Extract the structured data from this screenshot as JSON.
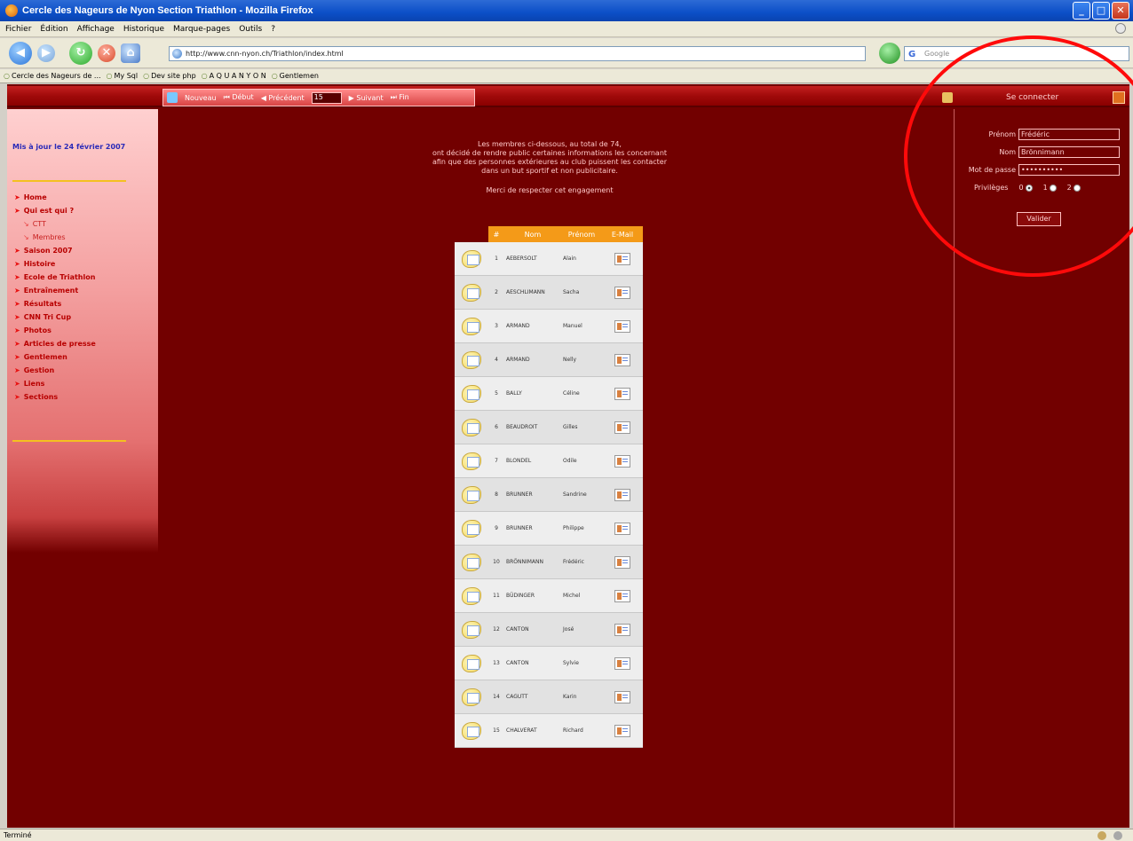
{
  "window": {
    "title": "Cercle des Nageurs de Nyon Section Triathlon - Mozilla Firefox"
  },
  "menu": [
    "Fichier",
    "Édition",
    "Affichage",
    "Historique",
    "Marque-pages",
    "Outils",
    "?"
  ],
  "address": {
    "url": "http://www.cnn-nyon.ch/Triathlon/index.html",
    "search_placeholder": "Google"
  },
  "bookmarks": [
    "Cercle des Nageurs de ...",
    "My Sql",
    "Dev site php",
    "A Q U A N Y O N",
    "Gentlemen"
  ],
  "pager": {
    "nouveau": "Nouveau",
    "debut": "Début",
    "precedent": "Précédent",
    "value": "15",
    "suivant": "Suivant",
    "fin": "Fin"
  },
  "connect": {
    "label": "Se connecter"
  },
  "sidebar": {
    "updated": "Mis à jour le 24 février 2007",
    "items": [
      {
        "label": "Home",
        "sub": false
      },
      {
        "label": "Qui est qui ?",
        "sub": false
      },
      {
        "label": "CTT",
        "sub": true
      },
      {
        "label": "Membres",
        "sub": true
      },
      {
        "label": "Saison 2007",
        "sub": false
      },
      {
        "label": "Histoire",
        "sub": false
      },
      {
        "label": "Ecole de Triathlon",
        "sub": false
      },
      {
        "label": "Entraînement",
        "sub": false
      },
      {
        "label": "Résultats",
        "sub": false
      },
      {
        "label": "CNN Tri Cup",
        "sub": false
      },
      {
        "label": "Photos",
        "sub": false
      },
      {
        "label": "Articles de presse",
        "sub": false
      },
      {
        "label": "Gentlemen",
        "sub": false
      },
      {
        "label": "Gestion",
        "sub": false
      },
      {
        "label": "Liens",
        "sub": false
      },
      {
        "label": "Sections",
        "sub": false
      }
    ]
  },
  "intro": {
    "lines": [
      "Les membres ci-dessous, au total de 74,",
      "ont décidé de rendre public certaines informations les concernant",
      "afin que des personnes extérieures au club puissent les contacter",
      "dans un but sportif et non publicitaire."
    ],
    "respect": "Merci de respecter cet engagement"
  },
  "members": {
    "headers": {
      "num": "#",
      "nom": "Nom",
      "prenom": "Prénom",
      "mail": "E-Mail"
    },
    "rows": [
      {
        "num": "1",
        "nom": "AEBERSOLT",
        "prenom": "Alain"
      },
      {
        "num": "2",
        "nom": "AESCHLIMANN",
        "prenom": "Sacha"
      },
      {
        "num": "3",
        "nom": "ARMAND",
        "prenom": "Manuel"
      },
      {
        "num": "4",
        "nom": "ARMAND",
        "prenom": "Nelly"
      },
      {
        "num": "5",
        "nom": "BALLY",
        "prenom": "Céline"
      },
      {
        "num": "6",
        "nom": "BEAUDROIT",
        "prenom": "Gilles"
      },
      {
        "num": "7",
        "nom": "BLONDEL",
        "prenom": "Odile"
      },
      {
        "num": "8",
        "nom": "BRUNNER",
        "prenom": "Sandrine"
      },
      {
        "num": "9",
        "nom": "BRUNNER",
        "prenom": "Philippe"
      },
      {
        "num": "10",
        "nom": "BRÖNNIMANN",
        "prenom": "Frédéric"
      },
      {
        "num": "11",
        "nom": "BÜDINGER",
        "prenom": "Michel"
      },
      {
        "num": "12",
        "nom": "CANTON",
        "prenom": "José"
      },
      {
        "num": "13",
        "nom": "CANTON",
        "prenom": "Sylvie"
      },
      {
        "num": "14",
        "nom": "CAGUTT",
        "prenom": "Karin"
      },
      {
        "num": "15",
        "nom": "CHALVERAT",
        "prenom": "Richard"
      }
    ]
  },
  "login": {
    "prenom_label": "Prénom",
    "prenom_value": "Frédéric",
    "nom_label": "Nom",
    "nom_value": "Brönnimann",
    "password_label": "Mot de passe",
    "password_value": "••••••••••",
    "privileges_label": "Privilèges",
    "privileges": [
      "0",
      "1",
      "2"
    ],
    "submit": "Valider"
  },
  "status": {
    "text": "Terminé"
  }
}
